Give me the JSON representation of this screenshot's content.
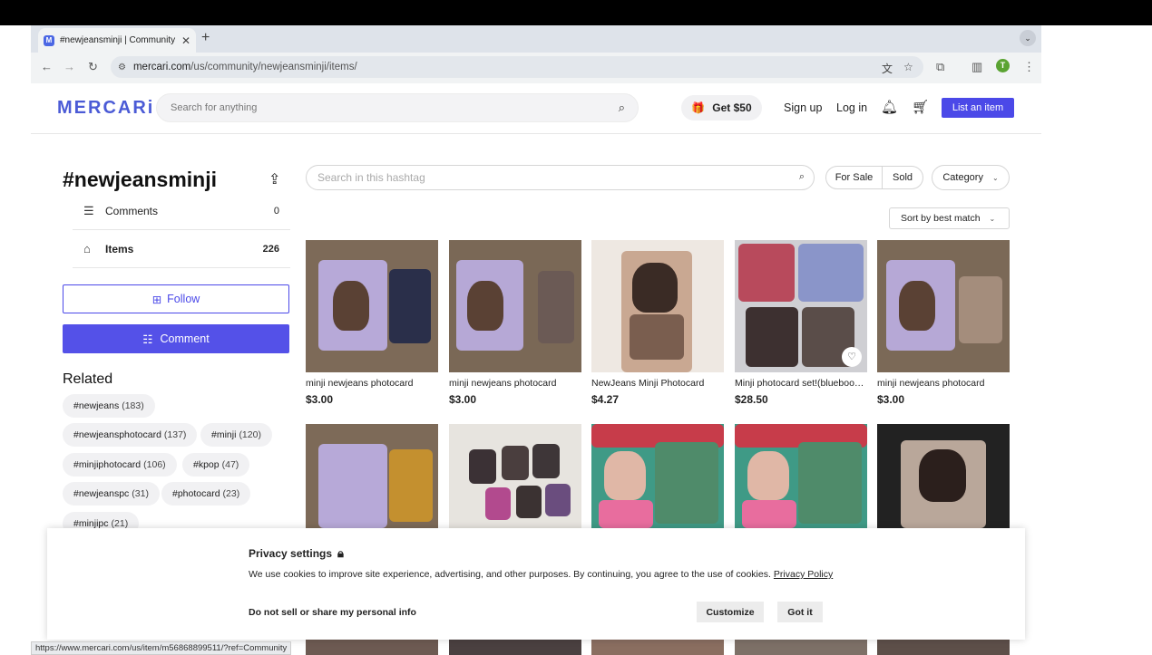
{
  "browser": {
    "tab_title": "#newjeansminji | Community",
    "url_domain": "mercari.com",
    "url_path": "/us/community/newjeansminji/items/",
    "profile_initial": "T",
    "status_url": "https://www.mercari.com/us/item/m56868899511/?ref=Community"
  },
  "header": {
    "logo": "MERCARi",
    "search_placeholder": "Search for anything",
    "get50": "Get $50",
    "sign_up": "Sign up",
    "log_in": "Log in",
    "list_item": "List an item"
  },
  "sidebar": {
    "title": "#newjeansminji",
    "comments_label": "Comments",
    "comments_count": "0",
    "items_label": "Items",
    "items_count": "226",
    "follow": "Follow",
    "comment": "Comment",
    "related_title": "Related",
    "related": [
      {
        "tag": "#newjeans",
        "count": "(183)"
      },
      {
        "tag": "#newjeansphotocard",
        "count": "(137)"
      },
      {
        "tag": "#minji",
        "count": "(120)"
      },
      {
        "tag": "#minjiphotocard",
        "count": "(106)"
      },
      {
        "tag": "#kpop",
        "count": "(47)"
      },
      {
        "tag": "#newjeanspc",
        "count": "(31)"
      },
      {
        "tag": "#photocard",
        "count": "(23)"
      },
      {
        "tag": "#minjipc",
        "count": "(21)"
      }
    ]
  },
  "filters": {
    "search_placeholder": "Search in this hashtag",
    "for_sale": "For Sale",
    "sold": "Sold",
    "category": "Category",
    "sort": "Sort by best match"
  },
  "items": [
    {
      "name": "minji newjeans photocard",
      "price": "$3.00"
    },
    {
      "name": "minji newjeans photocard",
      "price": "$3.00"
    },
    {
      "name": "NewJeans Minji Photocard",
      "price": "$4.27"
    },
    {
      "name": "Minji photocard set!(blueboo…",
      "price": "$28.50"
    },
    {
      "name": "minji newjeans photocard",
      "price": "$3.00"
    }
  ],
  "privacy": {
    "title": "Privacy settings",
    "body": "We use cookies to improve site experience, advertising, and other purposes. By continuing, you agree to the use of cookies.",
    "policy_link": "Privacy Policy",
    "do_not_sell": "Do not sell or share my personal info",
    "customize": "Customize",
    "got_it": "Got it"
  }
}
